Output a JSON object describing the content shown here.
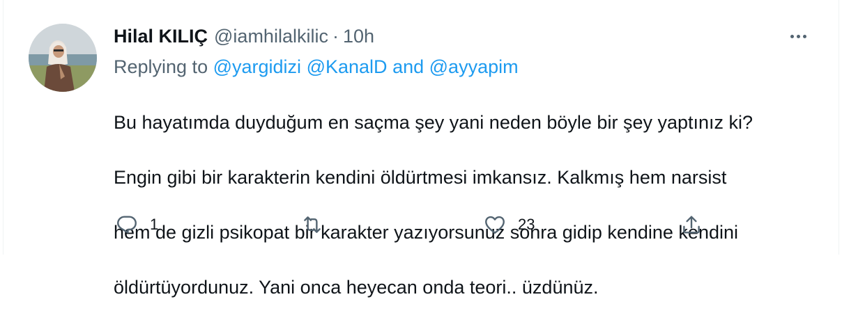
{
  "tweet": {
    "author": {
      "name": "Hilal KILIÇ",
      "handle": "@iamhilalkilic",
      "separator": "·",
      "time": "10h",
      "avatar_icon": "profile-photo"
    },
    "replying": {
      "prefix": "Replying to",
      "mentions": [
        "@yargidizi",
        "@KanalD",
        "@ayyapim"
      ],
      "and": "and"
    },
    "text_lines": [
      "Bu hayatımda duyduğum en saçma şey yani neden böyle bir şey yaptınız ki?",
      "Engin gibi bir karakterin kendini öldürtmesi imkansız. Kalkmış hem narsist",
      "hem de gizli psikopat bir karakter yazıyorsunuz sonra gidip kendine kendini",
      "öldürtüyordunuz. Yani onca heyecan onda teori.. üzdünüz."
    ],
    "actions": {
      "reply": {
        "icon": "reply-icon",
        "count": "1"
      },
      "retweet": {
        "icon": "retweet-icon",
        "count": ""
      },
      "like": {
        "icon": "heart-icon",
        "count": "23"
      },
      "share": {
        "icon": "share-icon"
      }
    },
    "more_icon": "more-icon"
  },
  "colors": {
    "text": "#0f1419",
    "secondary": "#536471",
    "link": "#1d9bf0",
    "border": "#eff3f4"
  }
}
